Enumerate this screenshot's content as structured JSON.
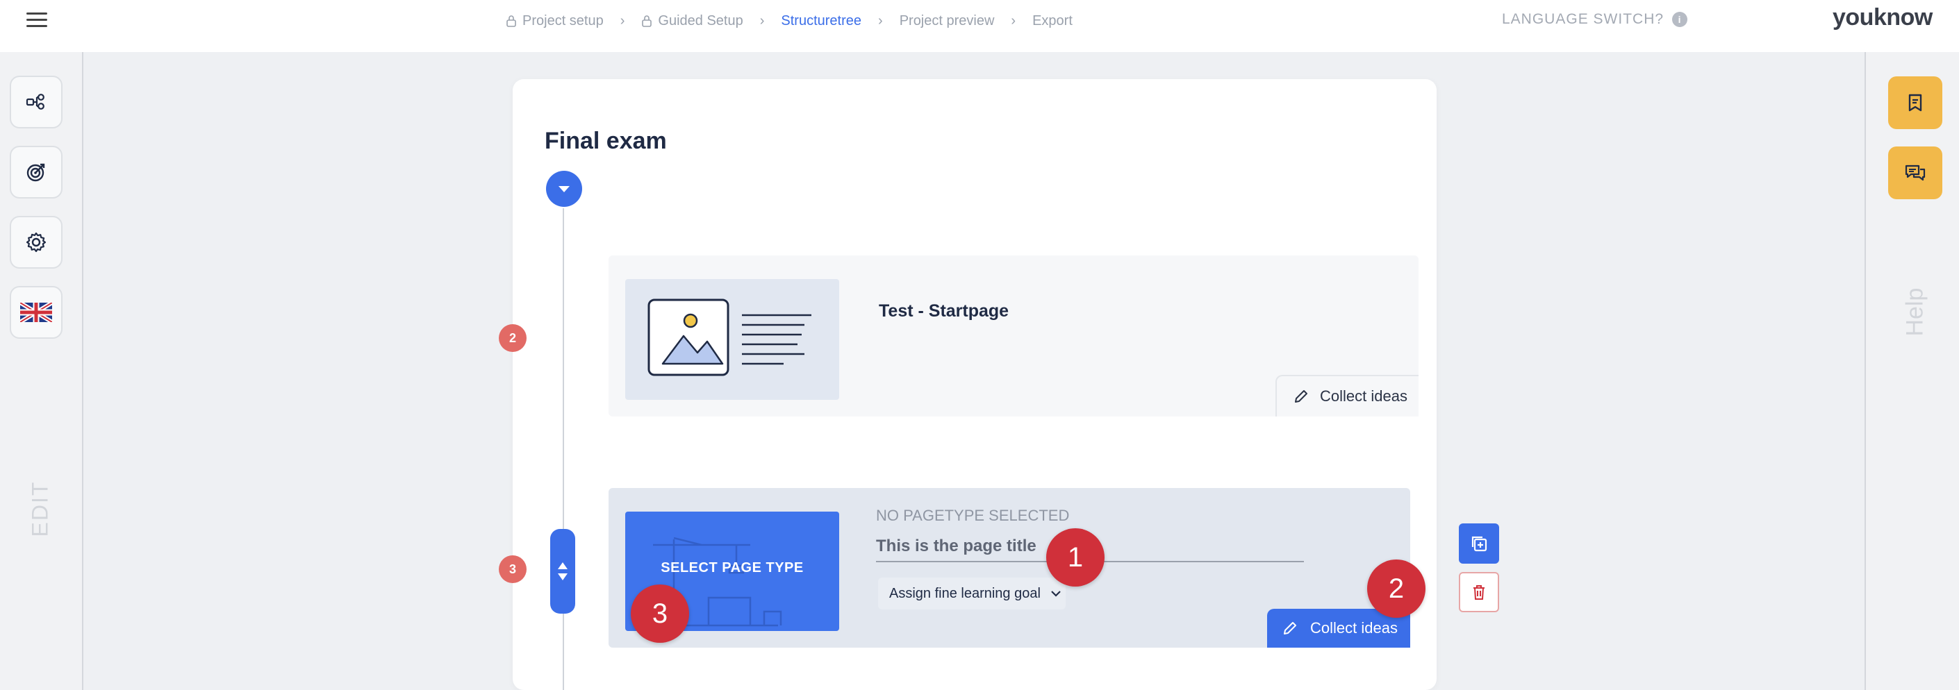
{
  "breadcrumbs": [
    {
      "label": "Project setup",
      "locked": true
    },
    {
      "label": "Guided Setup",
      "locked": true
    },
    {
      "label": "Structuretree",
      "active": true
    },
    {
      "label": "Project preview"
    },
    {
      "label": "Export"
    }
  ],
  "header": {
    "language_switch": "LANGUAGE SWITCH?",
    "info_icon": "i",
    "logo": "youknow"
  },
  "left_sidebar": {
    "buttons": [
      "structure-icon",
      "target-icon",
      "gear-icon",
      "uk-flag-icon"
    ],
    "edit_label": "EDIT"
  },
  "right_sidebar": {
    "buttons": [
      "bookmark-icon",
      "chat-icon"
    ],
    "help_label": "Help"
  },
  "main": {
    "title": "Final exam",
    "pages": [
      {
        "number": "2",
        "title": "Test - Startpage",
        "collect_label": "Collect ideas"
      },
      {
        "number": "3",
        "no_type_label": "NO PAGETYPE SELECTED",
        "select_type_label": "SELECT PAGE TYPE",
        "title_placeholder": "This is the page title",
        "goal_label": "Assign fine learning goal",
        "collect_label": "Collect ideas"
      }
    ]
  },
  "annotations": [
    "1",
    "2",
    "3"
  ],
  "colors": {
    "accent": "#3b6ee8",
    "help_buttons": "#f2b94a",
    "badge": "#e26a65",
    "marker": "#d0303a"
  }
}
